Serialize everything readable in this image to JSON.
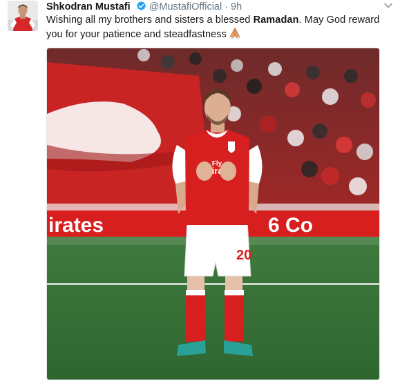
{
  "author": {
    "full_name": "Shkodran Mustafi",
    "handle": "@MustafiOfficial",
    "separator": "·",
    "time": "9h"
  },
  "tweet": {
    "text_before": "Wishing all my brothers and sisters a blessed ",
    "text_bold": "Ramadan",
    "text_after": ". May God reward you for your patience and steadfastness",
    "emoji": "folded-hands"
  },
  "photo": {
    "shirt_sponsor_line1": "Fly",
    "shirt_sponsor_line2": "Emirates",
    "shirt_number": "20",
    "board_text_left": "irates",
    "board_text_right": "6  Co"
  },
  "icons": {
    "verified": "verified-badge-icon",
    "caret": "chevron-down-icon",
    "emoji": "folded-hands-emoji-icon"
  },
  "colors": {
    "verified_blue": "#1da1f2",
    "arsenal_red": "#d81f1f",
    "pitch_green": "#3d7a3c"
  }
}
